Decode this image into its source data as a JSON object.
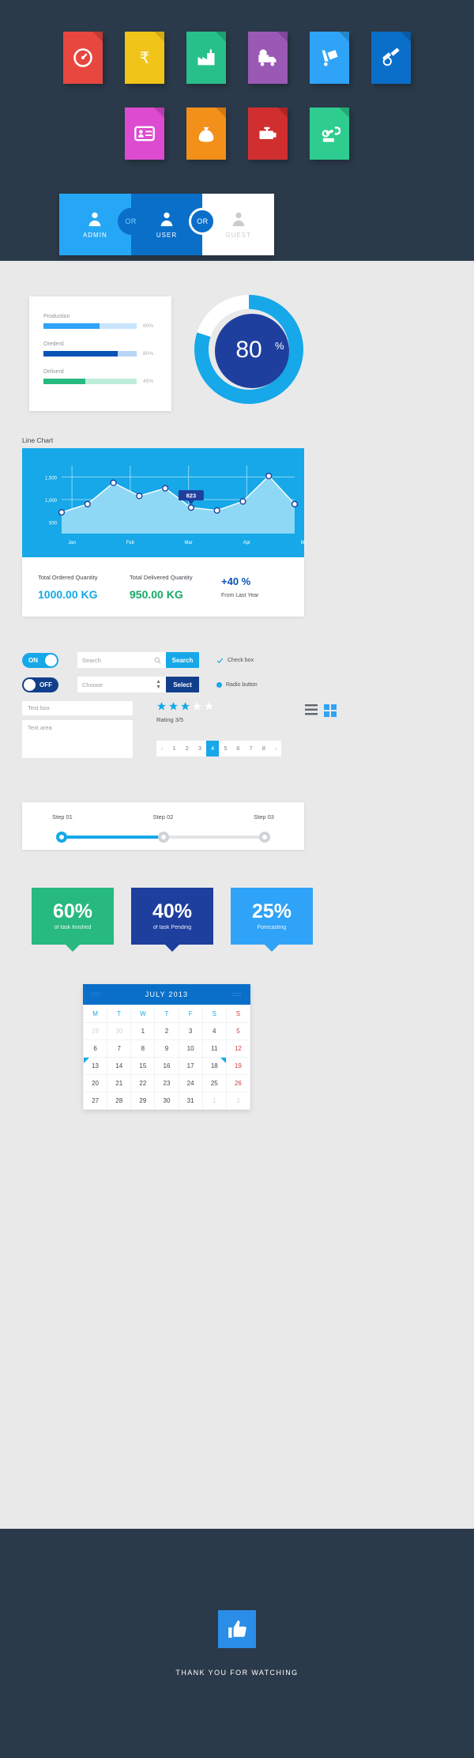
{
  "header": {
    "icons": [
      {
        "name": "speedometer-icon",
        "bg": "#e8473f",
        "fold": "#c23a33"
      },
      {
        "name": "rupee-icon",
        "bg": "#f0c419",
        "fold": "#d4a912"
      },
      {
        "name": "factory-icon",
        "bg": "#27c08a",
        "fold": "#1f9e72"
      },
      {
        "name": "delivery-clock-icon",
        "bg": "#9b59b6",
        "fold": "#80479a"
      },
      {
        "name": "hand-truck-icon",
        "bg": "#2fa3f7",
        "fold": "#2486cc"
      },
      {
        "name": "satellite-icon",
        "bg": "#0a6fc9",
        "fold": "#0a5aa3"
      },
      {
        "name": "id-card-icon",
        "bg": "#dd4bd0",
        "fold": "#b73cad"
      },
      {
        "name": "money-bag-icon",
        "bg": "#f39019",
        "fold": "#cf7712"
      },
      {
        "name": "generator-icon",
        "bg": "#d12f2f",
        "fold": "#ad2626"
      },
      {
        "name": "robot-arm-icon",
        "bg": "#2ecc8f",
        "fold": "#24a874"
      }
    ]
  },
  "role_selector": {
    "admin_label": "ADMIN",
    "user_label": "USER",
    "guest_label": "GUEST",
    "or_label_1": "OR",
    "or_label_2": "OR"
  },
  "progress_card": {
    "rows": [
      {
        "name": "Production",
        "percent": "60%",
        "value": 60,
        "fill": "#2fa3f7",
        "track": "#c9e4fb"
      },
      {
        "name": "Orederd",
        "percent": "80%",
        "value": 80,
        "fill": "#0a52b5",
        "track": "#b9d4f5"
      },
      {
        "name": "Deliverd",
        "percent": "45%",
        "value": 45,
        "fill": "#27b97f",
        "track": "#bdeeda"
      }
    ]
  },
  "donut": {
    "value": "80",
    "unit": "%",
    "percent": 80,
    "ring_color": "#16a8e8",
    "center_color": "#1e3f9e"
  },
  "line_chart_section": {
    "title": "Line Chart",
    "stats": [
      {
        "label": "Total Ordered Quantity",
        "value": "1000.00 KG"
      },
      {
        "label": "Total Delivered Quantity",
        "value": "950.00 KG"
      },
      {
        "label": "From Last Year",
        "value": "+40 %"
      }
    ]
  },
  "chart_data": {
    "type": "line",
    "title": "Line Chart",
    "xlabel": "",
    "ylabel": "",
    "ylim": [
      250,
      1750
    ],
    "yticks": [
      500,
      1000,
      1500
    ],
    "ytick_labels": [
      "500",
      "1,000",
      "1,500"
    ],
    "categories": [
      "Jan",
      "Feb",
      "Mar",
      "Apr",
      "May"
    ],
    "grid": true,
    "legend": false,
    "annotation": {
      "label": "823",
      "x_index": 5,
      "value": 823
    },
    "x": [
      0,
      0.5,
      1,
      1.5,
      2,
      2.5,
      3,
      3.5,
      4,
      4.5
    ],
    "values": [
      720,
      900,
      1370,
      1080,
      1250,
      823,
      760,
      960,
      1520,
      900
    ],
    "area_fill": "#8ed8f5",
    "line_color": "#ffffff",
    "plot_bg": "#16a8e8"
  },
  "form_controls": {
    "toggle_on": "ON",
    "toggle_off": "OFF",
    "search_placeholder": "Search",
    "search_button": "Search",
    "choose_placeholder": "Choose",
    "select_button": "Select",
    "checkbox_label": "Check box",
    "radio_label": "Radio button",
    "textbox_placeholder": "Text box",
    "textarea_placeholder": "Text area",
    "rating_label": "Rating 3/5",
    "rating_filled": 3,
    "rating_total": 5,
    "pagination": [
      "1",
      "2",
      "3",
      "4",
      "5",
      "6",
      "7",
      "8"
    ],
    "pagination_current": "4",
    "prev_icon": "chevron-left-icon",
    "next_icon": "chevron-right-icon"
  },
  "stepper": {
    "steps": [
      "Step 01",
      "Step 02",
      "Step 03"
    ],
    "progress_percent": 50
  },
  "percent_tiles": [
    {
      "value": "60%",
      "label": "of task finished",
      "bg": "#27b97f",
      "tail": "#27b97f"
    },
    {
      "value": "40%",
      "label": "of task Pending",
      "bg": "#1e3f9e",
      "tail": "#1e3f9e"
    },
    {
      "value": "25%",
      "label": "Forecasting",
      "bg": "#2fa3f7",
      "tail": "#2fa3f7"
    }
  ],
  "calendar": {
    "title": "JULY 2013",
    "prev_icon": "prev-dots-icon",
    "next_icon": "next-dots-icon",
    "weekdays": [
      "M",
      "T",
      "W",
      "T",
      "F",
      "S",
      "S"
    ],
    "weeks": [
      [
        {
          "d": "29",
          "t": "mute"
        },
        {
          "d": "30",
          "t": "mute"
        },
        {
          "d": "1"
        },
        {
          "d": "2"
        },
        {
          "d": "3"
        },
        {
          "d": "4"
        },
        {
          "d": "5"
        }
      ],
      [
        {
          "d": "6"
        },
        {
          "d": "7"
        },
        {
          "d": "8"
        },
        {
          "d": "9"
        },
        {
          "d": "10"
        },
        {
          "d": "11"
        },
        {
          "d": "12"
        }
      ],
      [
        {
          "d": "13",
          "t": "mark"
        },
        {
          "d": "14"
        },
        {
          "d": "15"
        },
        {
          "d": "16"
        },
        {
          "d": "17"
        },
        {
          "d": "18",
          "t": "markr"
        },
        {
          "d": "19"
        }
      ],
      [
        {
          "d": "20"
        },
        {
          "d": "21"
        },
        {
          "d": "22"
        },
        {
          "d": "23"
        },
        {
          "d": "24"
        },
        {
          "d": "25"
        },
        {
          "d": "26"
        }
      ],
      [
        {
          "d": "27"
        },
        {
          "d": "28"
        },
        {
          "d": "29"
        },
        {
          "d": "30"
        },
        {
          "d": "31"
        },
        {
          "d": "1",
          "t": "mute"
        },
        {
          "d": "2",
          "t": "mute"
        }
      ]
    ]
  },
  "footer": {
    "thumb_icon": "thumbs-up-icon",
    "text": "THANK YOU FOR WATCHING"
  }
}
